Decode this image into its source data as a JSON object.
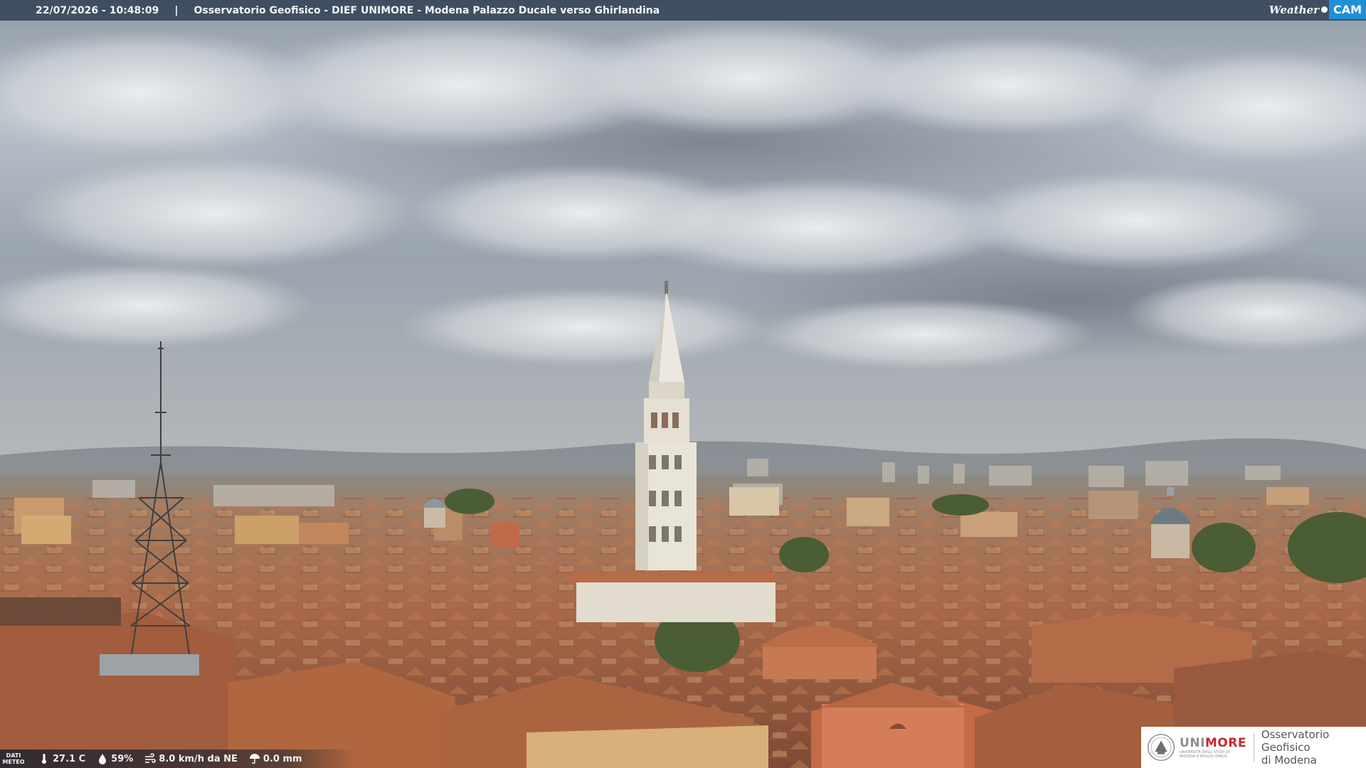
{
  "header": {
    "datetime": "22/07/2026 - 10:48:09",
    "separator": "|",
    "location": "Osservatorio Geofisico - DIEF UNIMORE - Modena Palazzo Ducale verso Ghirlandina"
  },
  "brand": {
    "weather": "Weather",
    "cam": "CAM"
  },
  "weather_data": {
    "label_line1": "DATI",
    "label_line2": "METEO",
    "temperature": "27.1 C",
    "humidity": "59%",
    "wind": "8.0 km/h da NE",
    "rain": "0.0 mm"
  },
  "logo": {
    "uni_prefix": "UNI",
    "uni_suffix": "MORE",
    "uni_sub1": "UNIVERSITÀ DEGLI STUDI DI",
    "uni_sub2": "MODENA E REGGIO EMILIA",
    "osservatorio_line1": "Osservatorio Geofisico",
    "osservatorio_line2": "di Modena"
  },
  "colors": {
    "cam_blue": "#1f8fd6",
    "unimore_red": "#c5282f",
    "roof_terracotta": "#b2653f"
  }
}
